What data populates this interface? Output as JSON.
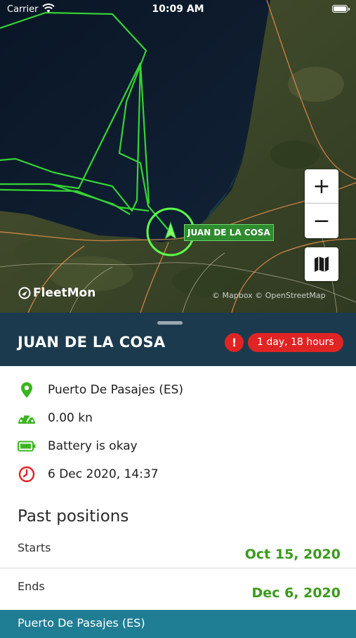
{
  "status_bar": {
    "carrier": "Carrier",
    "time": "10:09 AM"
  },
  "map": {
    "zoom_in_label": "+",
    "zoom_out_label": "−",
    "vessel_label": "JUAN DE LA COSA",
    "logo_text": "FleetMon",
    "attribution": "© Mapbox  © OpenStreetMap",
    "track_color": "#35d435",
    "position_marker_color": "#5cff4a",
    "icons": {
      "wifi": "wifi-icon",
      "layers": "map-layers-icon",
      "logo": "fleetmon-logo-icon"
    }
  },
  "vessel": {
    "name": "JUAN DE LA COSA",
    "alert_symbol": "!",
    "last_seen_duration": "1 day, 18 hours",
    "alert_color": "#e02424"
  },
  "details": [
    {
      "icon": "location-pin-icon",
      "text": "Puerto De Pasajes (ES)"
    },
    {
      "icon": "speedometer-icon",
      "text": "0.00 kn"
    },
    {
      "icon": "battery-icon",
      "text": "Battery is okay"
    },
    {
      "icon": "clock-icon",
      "text": "6 Dec 2020, 14:37"
    }
  ],
  "past_positions": {
    "title": "Past positions",
    "starts_label": "Starts",
    "starts_value": "Oct 15, 2020",
    "ends_label": "Ends",
    "ends_value": "Dec 6, 2020",
    "accent_color": "#3a9a1c"
  },
  "location_bar": {
    "label": "Puerto De Pasajes (ES)"
  }
}
